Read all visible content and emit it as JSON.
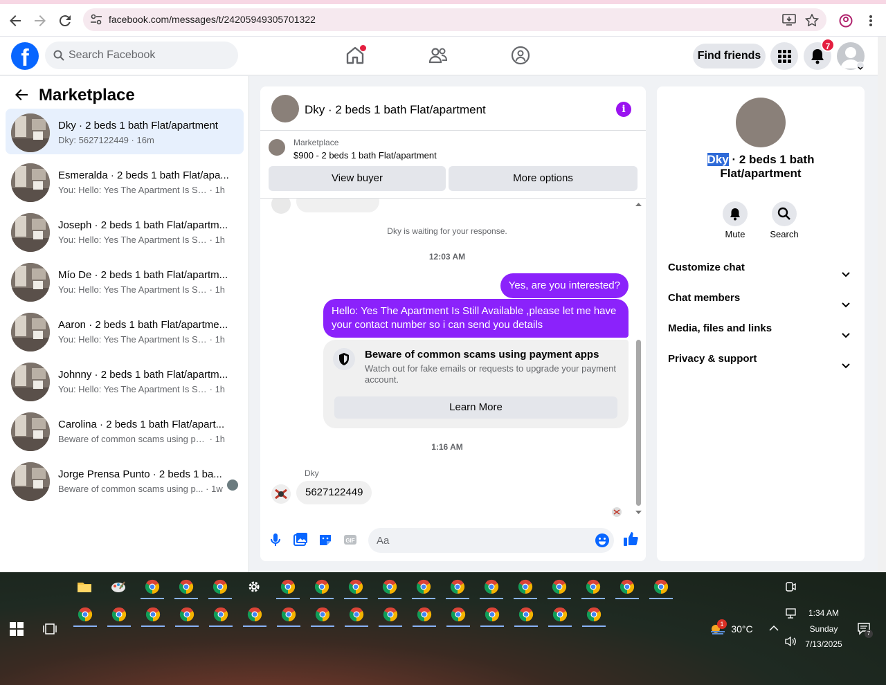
{
  "browser": {
    "url": "facebook.com/messages/t/24205949305701322"
  },
  "fb": {
    "logo": "f",
    "search_placeholder": "Search Facebook",
    "find_friends": "Find friends",
    "notifications_count": "7"
  },
  "sidebar": {
    "title": "Marketplace",
    "conversations": [
      {
        "name": "Dky · 2 beds 1 bath Flat/apartment",
        "preview": "Dky: 5627122449",
        "time": "· 16m",
        "active": true
      },
      {
        "name": "Esmeralda · 2 beds 1 bath Flat/apa...",
        "preview": "You: Hello: Yes The Apartment Is Still ...",
        "time": "· 1h"
      },
      {
        "name": "Joseph · 2 beds 1 bath Flat/apartm...",
        "preview": "You: Hello: Yes The Apartment Is Still ...",
        "time": "· 1h"
      },
      {
        "name": "Mío De · 2 beds 1 bath Flat/apartm...",
        "preview": "You: Hello: Yes The Apartment Is Still ...",
        "time": "· 1h"
      },
      {
        "name": "Aaron · 2 beds 1 bath Flat/apartme...",
        "preview": "You: Hello: Yes The Apartment Is Still ...",
        "time": "· 1h"
      },
      {
        "name": "Johnny · 2 beds 1 bath Flat/apartm...",
        "preview": "You: Hello: Yes The Apartment Is Still ...",
        "time": "· 1h"
      },
      {
        "name": "Carolina · 2 beds 1 bath Flat/apart...",
        "preview": "Beware of common scams using pay...",
        "time": "· 1h"
      },
      {
        "name": "Jorge Prensa Punto · 2 beds 1 ba...",
        "preview": "Beware of common scams using p...",
        "time": "· 1w"
      }
    ]
  },
  "chat": {
    "title": "Dky · 2 beds 1 bath Flat/apartment",
    "info_icon": "i",
    "listing_label": "Marketplace",
    "listing_title": "$900 - 2 beds 1 bath Flat/apartment",
    "view_buyer": "View buyer",
    "more_options": "More options",
    "waiting": "Dky is waiting for your response.",
    "time1": "12:03 AM",
    "msg_out1": "Yes, are you interested?",
    "msg_out2": "Hello: Yes The Apartment Is Still Available ,please let me have your contact number so i can send you details",
    "scam_title": "Beware of common scams using payment apps",
    "scam_desc": "Watch out for fake emails or requests to upgrade your payment account.",
    "learn_more": "Learn More",
    "time2": "1:16 AM",
    "sender": "Dky",
    "msg_in": "5627122449",
    "composer_placeholder": "Aa"
  },
  "rpanel": {
    "name_hl": "Dky",
    "name_rest": " · 2 beds 1 bath Flat/apartment",
    "mute": "Mute",
    "search": "Search",
    "sections": [
      "Customize chat",
      "Chat members",
      "Media, files and links",
      "Privacy & support"
    ]
  },
  "taskbar": {
    "temperature": "30°C",
    "weather_badge": "1",
    "time": "1:34 AM",
    "day": "Sunday",
    "date": "7/13/2025",
    "notif_count": "7"
  }
}
